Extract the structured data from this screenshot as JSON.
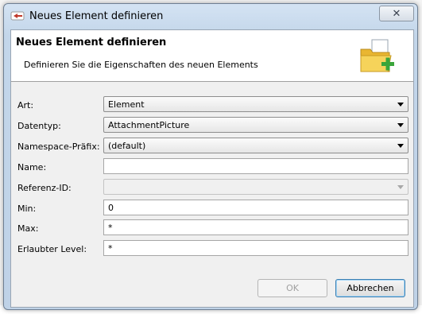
{
  "window": {
    "title": "Neues Element definieren",
    "close_glyph": "✕"
  },
  "header": {
    "title": "Neues Element definieren",
    "description": "Definieren Sie die Eigenschaften des neuen Elements",
    "icon": "folder-add-icon"
  },
  "form": {
    "art": {
      "label": "Art:",
      "value": "Element"
    },
    "datentyp": {
      "label": "Datentyp:",
      "value": "AttachmentPicture"
    },
    "namespace": {
      "label": "Namespace-Präfix:",
      "value": "(default)"
    },
    "name": {
      "label": "Name:",
      "value": ""
    },
    "referenz": {
      "label": "Referenz-ID:",
      "value": ""
    },
    "min": {
      "label": "Min:",
      "value": "0"
    },
    "max": {
      "label": "Max:",
      "value": "*"
    },
    "level": {
      "label": "Erlaubter Level:",
      "value": "*"
    }
  },
  "buttons": {
    "ok": "OK",
    "cancel": "Abbrechen"
  },
  "colors": {
    "accent_green": "#3aa53a",
    "folder_yellow": "#f4c842"
  }
}
